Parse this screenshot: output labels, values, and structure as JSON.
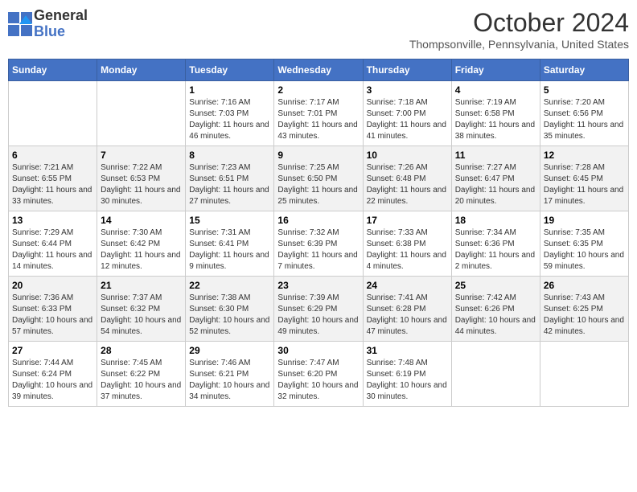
{
  "header": {
    "logo_general": "General",
    "logo_blue": "Blue",
    "month_title": "October 2024",
    "location": "Thompsonville, Pennsylvania, United States"
  },
  "days_of_week": [
    "Sunday",
    "Monday",
    "Tuesday",
    "Wednesday",
    "Thursday",
    "Friday",
    "Saturday"
  ],
  "weeks": [
    [
      {
        "day": "",
        "sunrise": "",
        "sunset": "",
        "daylight": ""
      },
      {
        "day": "",
        "sunrise": "",
        "sunset": "",
        "daylight": ""
      },
      {
        "day": "1",
        "sunrise": "Sunrise: 7:16 AM",
        "sunset": "Sunset: 7:03 PM",
        "daylight": "Daylight: 11 hours and 46 minutes."
      },
      {
        "day": "2",
        "sunrise": "Sunrise: 7:17 AM",
        "sunset": "Sunset: 7:01 PM",
        "daylight": "Daylight: 11 hours and 43 minutes."
      },
      {
        "day": "3",
        "sunrise": "Sunrise: 7:18 AM",
        "sunset": "Sunset: 7:00 PM",
        "daylight": "Daylight: 11 hours and 41 minutes."
      },
      {
        "day": "4",
        "sunrise": "Sunrise: 7:19 AM",
        "sunset": "Sunset: 6:58 PM",
        "daylight": "Daylight: 11 hours and 38 minutes."
      },
      {
        "day": "5",
        "sunrise": "Sunrise: 7:20 AM",
        "sunset": "Sunset: 6:56 PM",
        "daylight": "Daylight: 11 hours and 35 minutes."
      }
    ],
    [
      {
        "day": "6",
        "sunrise": "Sunrise: 7:21 AM",
        "sunset": "Sunset: 6:55 PM",
        "daylight": "Daylight: 11 hours and 33 minutes."
      },
      {
        "day": "7",
        "sunrise": "Sunrise: 7:22 AM",
        "sunset": "Sunset: 6:53 PM",
        "daylight": "Daylight: 11 hours and 30 minutes."
      },
      {
        "day": "8",
        "sunrise": "Sunrise: 7:23 AM",
        "sunset": "Sunset: 6:51 PM",
        "daylight": "Daylight: 11 hours and 27 minutes."
      },
      {
        "day": "9",
        "sunrise": "Sunrise: 7:25 AM",
        "sunset": "Sunset: 6:50 PM",
        "daylight": "Daylight: 11 hours and 25 minutes."
      },
      {
        "day": "10",
        "sunrise": "Sunrise: 7:26 AM",
        "sunset": "Sunset: 6:48 PM",
        "daylight": "Daylight: 11 hours and 22 minutes."
      },
      {
        "day": "11",
        "sunrise": "Sunrise: 7:27 AM",
        "sunset": "Sunset: 6:47 PM",
        "daylight": "Daylight: 11 hours and 20 minutes."
      },
      {
        "day": "12",
        "sunrise": "Sunrise: 7:28 AM",
        "sunset": "Sunset: 6:45 PM",
        "daylight": "Daylight: 11 hours and 17 minutes."
      }
    ],
    [
      {
        "day": "13",
        "sunrise": "Sunrise: 7:29 AM",
        "sunset": "Sunset: 6:44 PM",
        "daylight": "Daylight: 11 hours and 14 minutes."
      },
      {
        "day": "14",
        "sunrise": "Sunrise: 7:30 AM",
        "sunset": "Sunset: 6:42 PM",
        "daylight": "Daylight: 11 hours and 12 minutes."
      },
      {
        "day": "15",
        "sunrise": "Sunrise: 7:31 AM",
        "sunset": "Sunset: 6:41 PM",
        "daylight": "Daylight: 11 hours and 9 minutes."
      },
      {
        "day": "16",
        "sunrise": "Sunrise: 7:32 AM",
        "sunset": "Sunset: 6:39 PM",
        "daylight": "Daylight: 11 hours and 7 minutes."
      },
      {
        "day": "17",
        "sunrise": "Sunrise: 7:33 AM",
        "sunset": "Sunset: 6:38 PM",
        "daylight": "Daylight: 11 hours and 4 minutes."
      },
      {
        "day": "18",
        "sunrise": "Sunrise: 7:34 AM",
        "sunset": "Sunset: 6:36 PM",
        "daylight": "Daylight: 11 hours and 2 minutes."
      },
      {
        "day": "19",
        "sunrise": "Sunrise: 7:35 AM",
        "sunset": "Sunset: 6:35 PM",
        "daylight": "Daylight: 10 hours and 59 minutes."
      }
    ],
    [
      {
        "day": "20",
        "sunrise": "Sunrise: 7:36 AM",
        "sunset": "Sunset: 6:33 PM",
        "daylight": "Daylight: 10 hours and 57 minutes."
      },
      {
        "day": "21",
        "sunrise": "Sunrise: 7:37 AM",
        "sunset": "Sunset: 6:32 PM",
        "daylight": "Daylight: 10 hours and 54 minutes."
      },
      {
        "day": "22",
        "sunrise": "Sunrise: 7:38 AM",
        "sunset": "Sunset: 6:30 PM",
        "daylight": "Daylight: 10 hours and 52 minutes."
      },
      {
        "day": "23",
        "sunrise": "Sunrise: 7:39 AM",
        "sunset": "Sunset: 6:29 PM",
        "daylight": "Daylight: 10 hours and 49 minutes."
      },
      {
        "day": "24",
        "sunrise": "Sunrise: 7:41 AM",
        "sunset": "Sunset: 6:28 PM",
        "daylight": "Daylight: 10 hours and 47 minutes."
      },
      {
        "day": "25",
        "sunrise": "Sunrise: 7:42 AM",
        "sunset": "Sunset: 6:26 PM",
        "daylight": "Daylight: 10 hours and 44 minutes."
      },
      {
        "day": "26",
        "sunrise": "Sunrise: 7:43 AM",
        "sunset": "Sunset: 6:25 PM",
        "daylight": "Daylight: 10 hours and 42 minutes."
      }
    ],
    [
      {
        "day": "27",
        "sunrise": "Sunrise: 7:44 AM",
        "sunset": "Sunset: 6:24 PM",
        "daylight": "Daylight: 10 hours and 39 minutes."
      },
      {
        "day": "28",
        "sunrise": "Sunrise: 7:45 AM",
        "sunset": "Sunset: 6:22 PM",
        "daylight": "Daylight: 10 hours and 37 minutes."
      },
      {
        "day": "29",
        "sunrise": "Sunrise: 7:46 AM",
        "sunset": "Sunset: 6:21 PM",
        "daylight": "Daylight: 10 hours and 34 minutes."
      },
      {
        "day": "30",
        "sunrise": "Sunrise: 7:47 AM",
        "sunset": "Sunset: 6:20 PM",
        "daylight": "Daylight: 10 hours and 32 minutes."
      },
      {
        "day": "31",
        "sunrise": "Sunrise: 7:48 AM",
        "sunset": "Sunset: 6:19 PM",
        "daylight": "Daylight: 10 hours and 30 minutes."
      },
      {
        "day": "",
        "sunrise": "",
        "sunset": "",
        "daylight": ""
      },
      {
        "day": "",
        "sunrise": "",
        "sunset": "",
        "daylight": ""
      }
    ]
  ]
}
